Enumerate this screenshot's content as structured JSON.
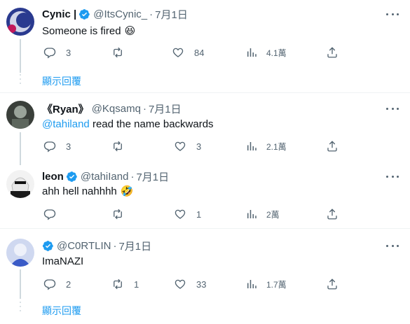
{
  "posts": [
    {
      "name": "Cynic |",
      "handle": "@ItsCynic_",
      "dot": "·",
      "date": "7月1日",
      "text": "Someone is fired",
      "emoji": "😆",
      "replies": "3",
      "reposts": "",
      "likes": "84",
      "views": "4.1萬"
    },
    {
      "name": "《Ryan》",
      "handle": "@Kqsamq",
      "dot": "·",
      "date": "7月1日",
      "mention": "@tahiland",
      "text": " read the name backwards",
      "replies": "3",
      "reposts": "",
      "likes": "3",
      "views": "2.1萬"
    },
    {
      "name": "leon",
      "handle": "@tahiIand",
      "dot": "·",
      "date": "7月1日",
      "text": "ahh hell nahhhh",
      "emoji": "🤣",
      "replies": "",
      "reposts": "",
      "likes": "1",
      "views": "2萬"
    },
    {
      "name": "",
      "handle": "@C0RTLIN",
      "dot": "·",
      "date": "7月1日",
      "text": "ImaNAZI",
      "replies": "2",
      "reposts": "1",
      "likes": "33",
      "views": "1.7萬"
    }
  ],
  "show_replies_label": "顯示回覆",
  "colors": {
    "accent": "#1d9bf0",
    "muted": "#536471",
    "verified": "#1d9bf0"
  }
}
